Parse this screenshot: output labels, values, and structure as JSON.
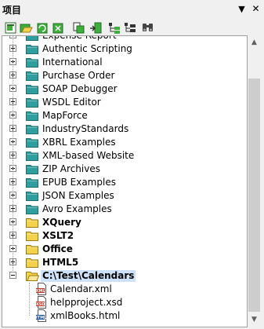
{
  "panel": {
    "title": "项目"
  },
  "toolbar": {
    "buttons": [
      "new-project-icon",
      "open-project-icon",
      "reload-project-icon",
      "close-project-icon",
      "add-files-icon",
      "add-active-file-icon",
      "add-folder-icon",
      "find-icon"
    ]
  },
  "tree": {
    "items": [
      {
        "label": "Expense Report",
        "bold": false
      },
      {
        "label": "Authentic Scripting",
        "bold": false
      },
      {
        "label": "International",
        "bold": false
      },
      {
        "label": "Purchase Order",
        "bold": false
      },
      {
        "label": "SOAP Debugger",
        "bold": false
      },
      {
        "label": "WSDL Editor",
        "bold": false
      },
      {
        "label": "MapForce",
        "bold": false
      },
      {
        "label": "IndustryStandards",
        "bold": false
      },
      {
        "label": "XBRL Examples",
        "bold": false
      },
      {
        "label": "XML-based Website",
        "bold": false
      },
      {
        "label": "ZIP Archives",
        "bold": false
      },
      {
        "label": "EPUB Examples",
        "bold": false
      },
      {
        "label": "JSON Examples",
        "bold": false
      },
      {
        "label": "Avro Examples",
        "bold": false
      },
      {
        "label": "XQuery",
        "bold": true
      },
      {
        "label": "XSLT2",
        "bold": true
      },
      {
        "label": "Office",
        "bold": true
      },
      {
        "label": "HTML5",
        "bold": true
      },
      {
        "label": "C:\\Test\\Calendars",
        "bold": true
      }
    ],
    "children": [
      {
        "label": "Calendar.xml",
        "type": "xml"
      },
      {
        "label": "helpproject.xsd",
        "type": "xsd"
      },
      {
        "label": "xmlBooks.html",
        "type": "html"
      }
    ]
  },
  "colors": {
    "project_folder": "#2e9e9e",
    "user_folder": "#f5d24c",
    "selection": "#cde2f8"
  }
}
